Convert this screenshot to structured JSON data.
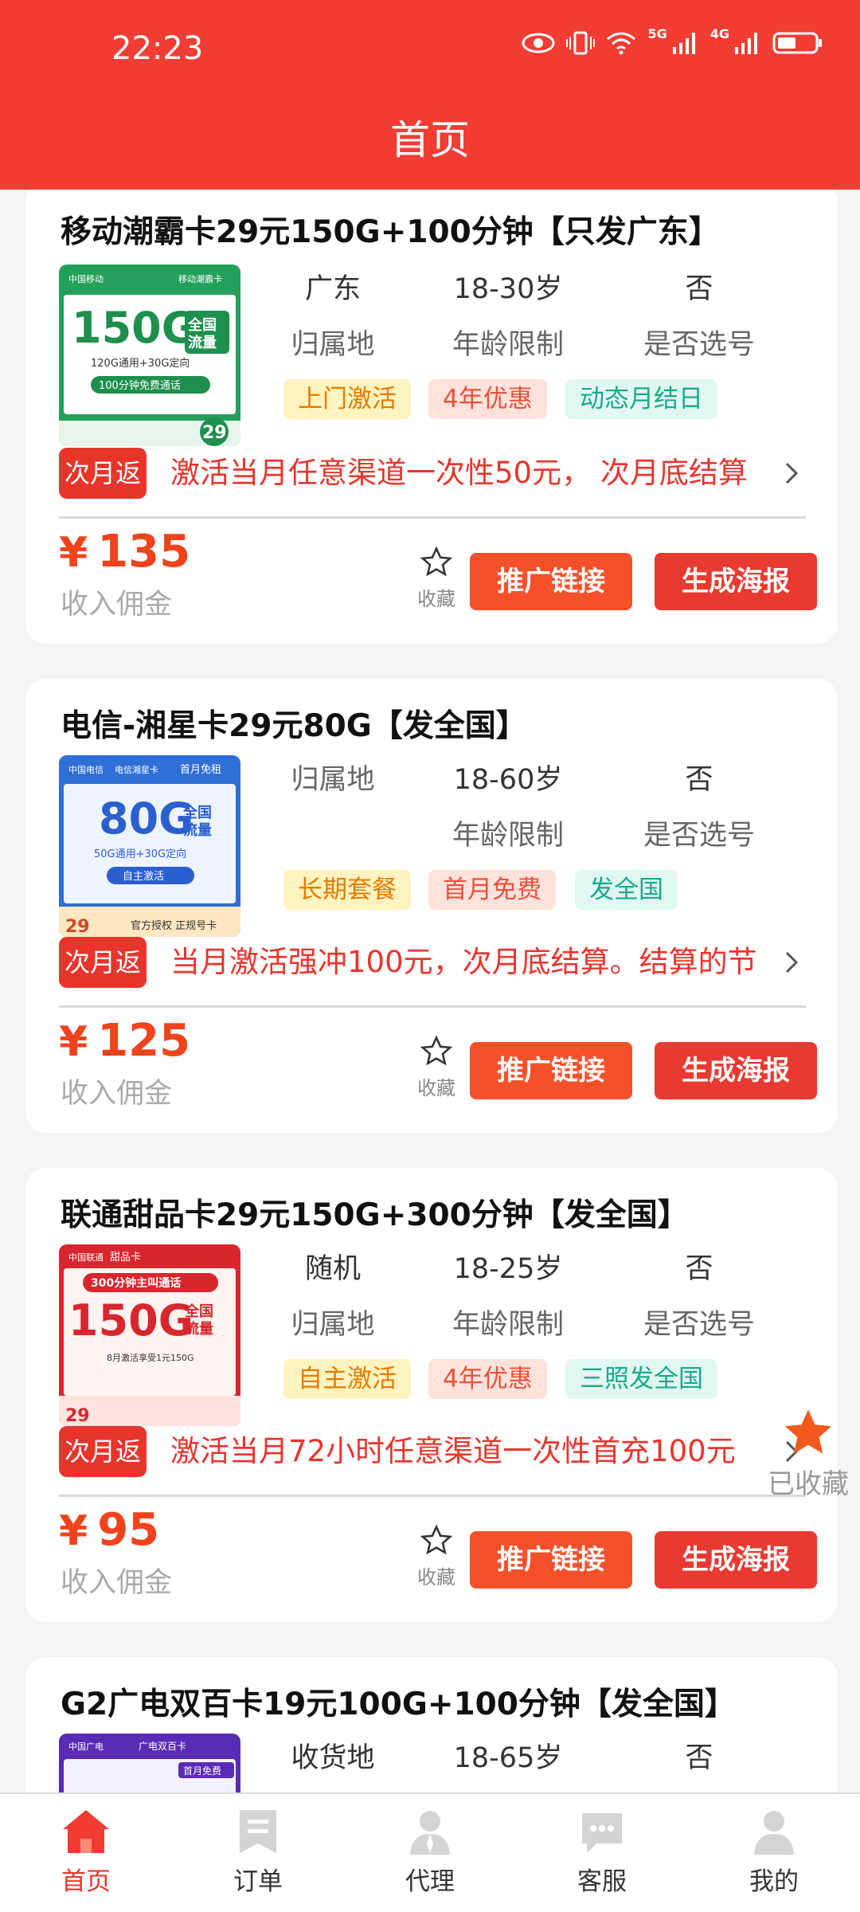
{
  "status_bar": {
    "time": "22:23",
    "net1": "5G",
    "net2": "4G"
  },
  "header": {
    "title": "首页"
  },
  "cards": [
    {
      "title": "移动潮霸卡29元150G+100分钟【只发广东】",
      "thumb": {
        "brand": "中国移动",
        "name": "移动潮霸卡",
        "data": "150G",
        "badge": "全国流量",
        "sub": "120G通用+30G定向",
        "minutes": "100分钟免费通话",
        "price": "29"
      },
      "info": [
        {
          "value": "广东",
          "label": "归属地"
        },
        {
          "value": "18-30岁",
          "label": "年龄限制"
        },
        {
          "value": "否",
          "label": "是否选号"
        }
      ],
      "tags": [
        "上门激活",
        "4年优惠",
        "动态月结日"
      ],
      "rebate_badge": "次月返",
      "rebate_text": "激活当月任意渠道一次性50元， 次月底结算",
      "price": "135",
      "income_label": "收入佣金",
      "fav_label": "收藏",
      "link_label": "推广链接",
      "poster_label": "生成海报"
    },
    {
      "title": "电信-湘星卡29元80G【发全国】",
      "thumb": {
        "brand": "中国电信",
        "name": "电信湘星卡",
        "data": "80G",
        "badge": "全国流量",
        "sub": "50G通用+30G定向",
        "minutes": "自主激活",
        "price": "29"
      },
      "info": [
        {
          "value": "",
          "label": "归属地"
        },
        {
          "value": "18-60岁",
          "label": "年龄限制"
        },
        {
          "value": "否",
          "label": "是否选号"
        }
      ],
      "tags": [
        "长期套餐",
        "首月免费",
        "发全国"
      ],
      "rebate_badge": "次月返",
      "rebate_text": "当月激活强冲100元，次月底结算。结算的节",
      "price": "125",
      "income_label": "收入佣金",
      "fav_label": "收藏",
      "link_label": "推广链接",
      "poster_label": "生成海报"
    },
    {
      "title": "联通甜品卡29元150G+300分钟【发全国】",
      "thumb": {
        "brand": "中国联通",
        "name": "甜品卡",
        "data": "150G",
        "badge": "全国流量",
        "sub": "8月激活享受1元150G",
        "minutes": "300分钟主叫通话",
        "price": "29"
      },
      "info": [
        {
          "value": "随机",
          "label": "归属地"
        },
        {
          "value": "18-25岁",
          "label": "年龄限制"
        },
        {
          "value": "否",
          "label": "是否选号"
        }
      ],
      "tags": [
        "自主激活",
        "4年优惠",
        "三照发全国"
      ],
      "rebate_badge": "次月返",
      "rebate_text": "激活当月72小时任意渠道一次性首充100元",
      "price": "95",
      "income_label": "收入佣金",
      "fav_label": "收藏",
      "link_label": "推广链接",
      "poster_label": "生成海报"
    },
    {
      "title": "G2广电双百卡19元100G+100分钟【发全国】",
      "thumb": {
        "brand": "中国广电",
        "name": "广电双百卡",
        "badge": "首月免费"
      },
      "info": [
        {
          "value": "收货地",
          "label": ""
        },
        {
          "value": "18-65岁",
          "label": ""
        },
        {
          "value": "否",
          "label": ""
        }
      ]
    }
  ],
  "floating_fav": {
    "label": "已收藏"
  },
  "tabbar": [
    {
      "label": "首页",
      "icon": "home-icon",
      "active": true
    },
    {
      "label": "订单",
      "icon": "order-icon",
      "active": false
    },
    {
      "label": "代理",
      "icon": "agent-icon",
      "active": false
    },
    {
      "label": "客服",
      "icon": "service-icon",
      "active": false
    },
    {
      "label": "我的",
      "icon": "profile-icon",
      "active": false
    }
  ],
  "colors": {
    "brand": "#f13d34",
    "price": "#f0431d",
    "link_button": "#f4512b",
    "poster_button": "#e83a30",
    "star": "#f25a1d"
  }
}
